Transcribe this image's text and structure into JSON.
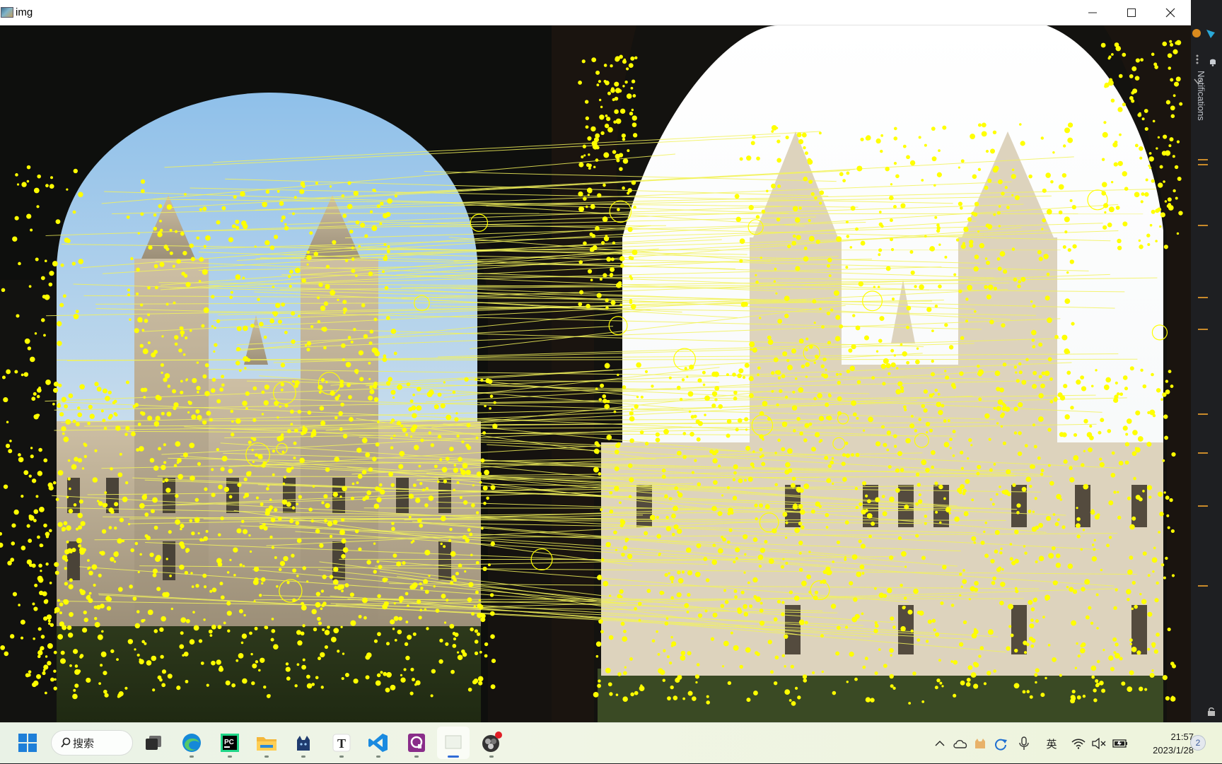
{
  "window": {
    "title": "img",
    "controls": {
      "minimize": "minimize-icon",
      "maximize": "maximize-icon",
      "close": "close-icon"
    }
  },
  "image_view": {
    "description_icon": "feature-match-visualization",
    "marker_color": "#ffff00",
    "line_color": "#f2f25a",
    "left_scene": "building-through-arch-blue-sky",
    "right_scene": "building-through-arch-overexposed-sky"
  },
  "side_panel": {
    "label": "Notifications"
  },
  "taskbar": {
    "search_label": "搜索",
    "apps": [
      "windows-start-icon",
      "search-icon",
      "task-view-icon",
      "edge-icon",
      "pycharm-icon",
      "file-explorer-icon",
      "cat-app-icon",
      "typora-icon",
      "vscode-icon",
      "pdf-app-icon",
      "active-window-icon",
      "obs-icon"
    ],
    "pycharm_label": "PC",
    "typora_label": "T",
    "ime_label": "英",
    "time": "21:57",
    "date": "2023/1/28",
    "notification_count": "2"
  }
}
